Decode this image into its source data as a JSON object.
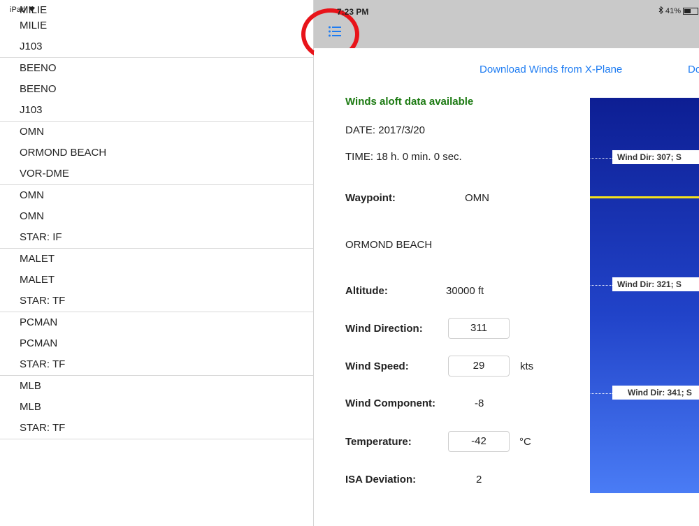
{
  "status_bar": {
    "device": "iPad",
    "time": "7:23 PM",
    "battery": "41%"
  },
  "waypoints": [
    {
      "lines": [
        "MILIE",
        "MILIE",
        "J103"
      ]
    },
    {
      "lines": [
        "BEENO",
        "BEENO",
        "J103"
      ]
    },
    {
      "lines": [
        "OMN",
        "ORMOND BEACH",
        "VOR-DME"
      ]
    },
    {
      "lines": [
        "OMN",
        "OMN",
        "STAR: IF"
      ]
    },
    {
      "lines": [
        "MALET",
        "MALET",
        "STAR: TF"
      ]
    },
    {
      "lines": [
        "PCMAN",
        "PCMAN",
        "STAR: TF"
      ]
    },
    {
      "lines": [
        "MLB",
        "MLB",
        "STAR: TF"
      ]
    }
  ],
  "detail": {
    "download_xplane": "Download Winds from X-Plane",
    "download_other": "Do",
    "availability": "Winds aloft data available",
    "date": "DATE: 2017/3/20",
    "time": "TIME: 18 h. 0 min. 0 sec.",
    "waypoint_label": "Waypoint:",
    "waypoint_value": "OMN",
    "waypoint_name": "ORMOND BEACH",
    "altitude_label": "Altitude:",
    "altitude_value": "30000 ft",
    "wind_dir_label": "Wind Direction:",
    "wind_dir_value": "311",
    "wind_speed_label": "Wind Speed:",
    "wind_speed_value": "29",
    "wind_speed_unit": "kts",
    "wind_comp_label": "Wind Component:",
    "wind_comp_value": "-8",
    "temp_label": "Temperature:",
    "temp_value": "-42",
    "temp_unit": "°C",
    "isa_label": "ISA Deviation:",
    "isa_value": "2"
  },
  "chart_tags": [
    "Wind Dir: 307; S",
    "Wind Dir: 321; S",
    "Wind Dir: 341; S"
  ],
  "colors": {
    "link": "#1e7cf2",
    "available": "#1c7a12",
    "highlight": "#e8141a",
    "marker": "#f5e21c"
  }
}
